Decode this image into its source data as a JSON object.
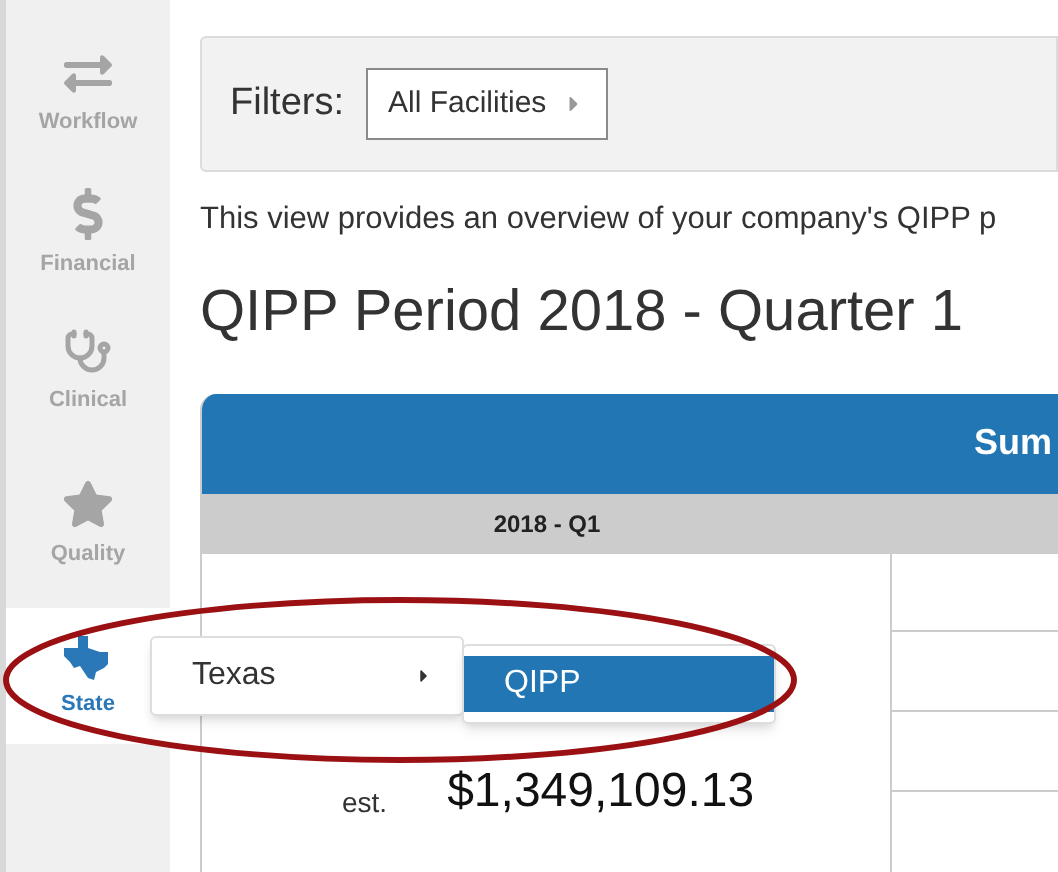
{
  "sidebar": {
    "items": [
      {
        "kind": "workflow",
        "label": "Workflow",
        "selected": false
      },
      {
        "kind": "financial",
        "label": "Financial",
        "selected": false
      },
      {
        "kind": "clinical",
        "label": "Clinical",
        "selected": false
      },
      {
        "kind": "quality",
        "label": "Quality",
        "selected": false
      },
      {
        "kind": "state",
        "label": "State",
        "selected": true
      }
    ]
  },
  "filters": {
    "label": "Filters:",
    "dropdown": "All Facilities"
  },
  "description": "This view provides an overview of your company's QIPP p",
  "title": "QIPP Period 2018 - Quarter 1",
  "table": {
    "header": "Sum",
    "column_header": "2018 - Q1",
    "est_label": "est.",
    "amount": "$1,349,109.13"
  },
  "menu": {
    "items": [
      {
        "label": "Texas",
        "selected": false
      }
    ]
  },
  "submenu": {
    "items": [
      {
        "label": "QIPP",
        "selected": true
      }
    ]
  }
}
